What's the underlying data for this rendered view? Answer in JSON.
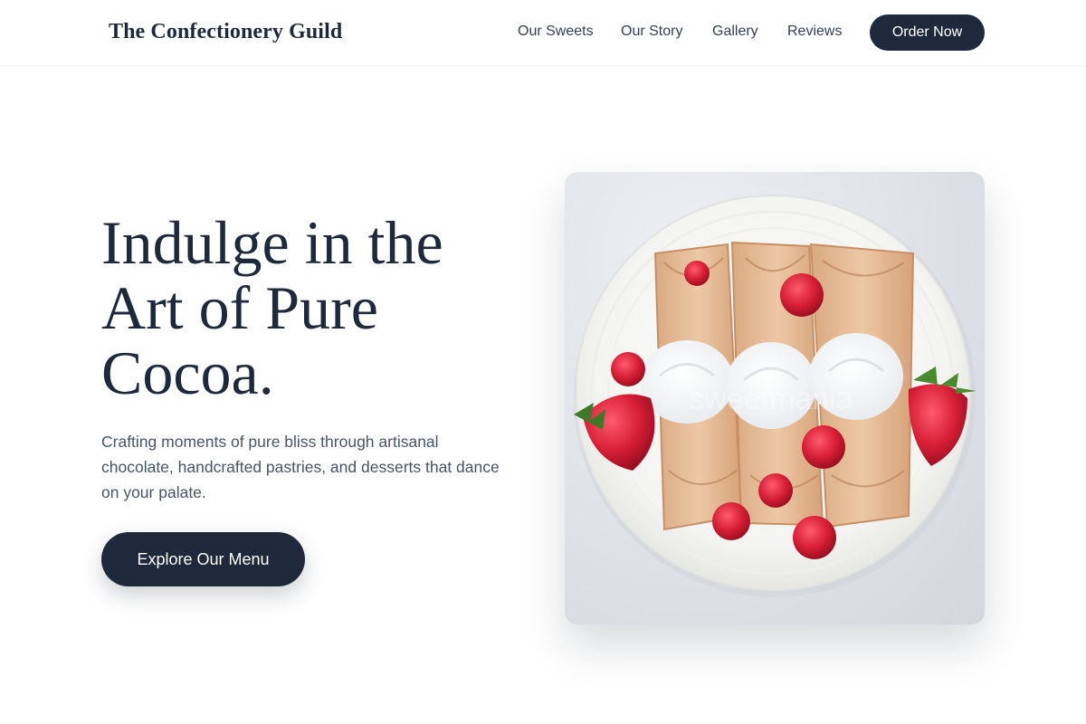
{
  "header": {
    "logo": "The Confectionery Guild",
    "nav": [
      "Our Sweets",
      "Our Story",
      "Gallery",
      "Reviews"
    ],
    "cta_label": "Order Now"
  },
  "hero": {
    "title_lines": [
      "Indulge in the",
      "Art of Pure",
      "Cocoa."
    ],
    "subtitle_lines": [
      "Crafting moments of pure bliss through artisanal",
      "chocolate, handcrafted pastries, and desserts that dance",
      "on your palate."
    ],
    "cta_label": "Explore Our Menu",
    "image": {
      "subject": "crepes-with-whipped-cream-and-berries",
      "watermark": "sweetmania"
    }
  },
  "colors": {
    "primary": "#1e293b",
    "text_muted": "#475569",
    "nav_text": "#334155",
    "background": "#ffffff"
  }
}
